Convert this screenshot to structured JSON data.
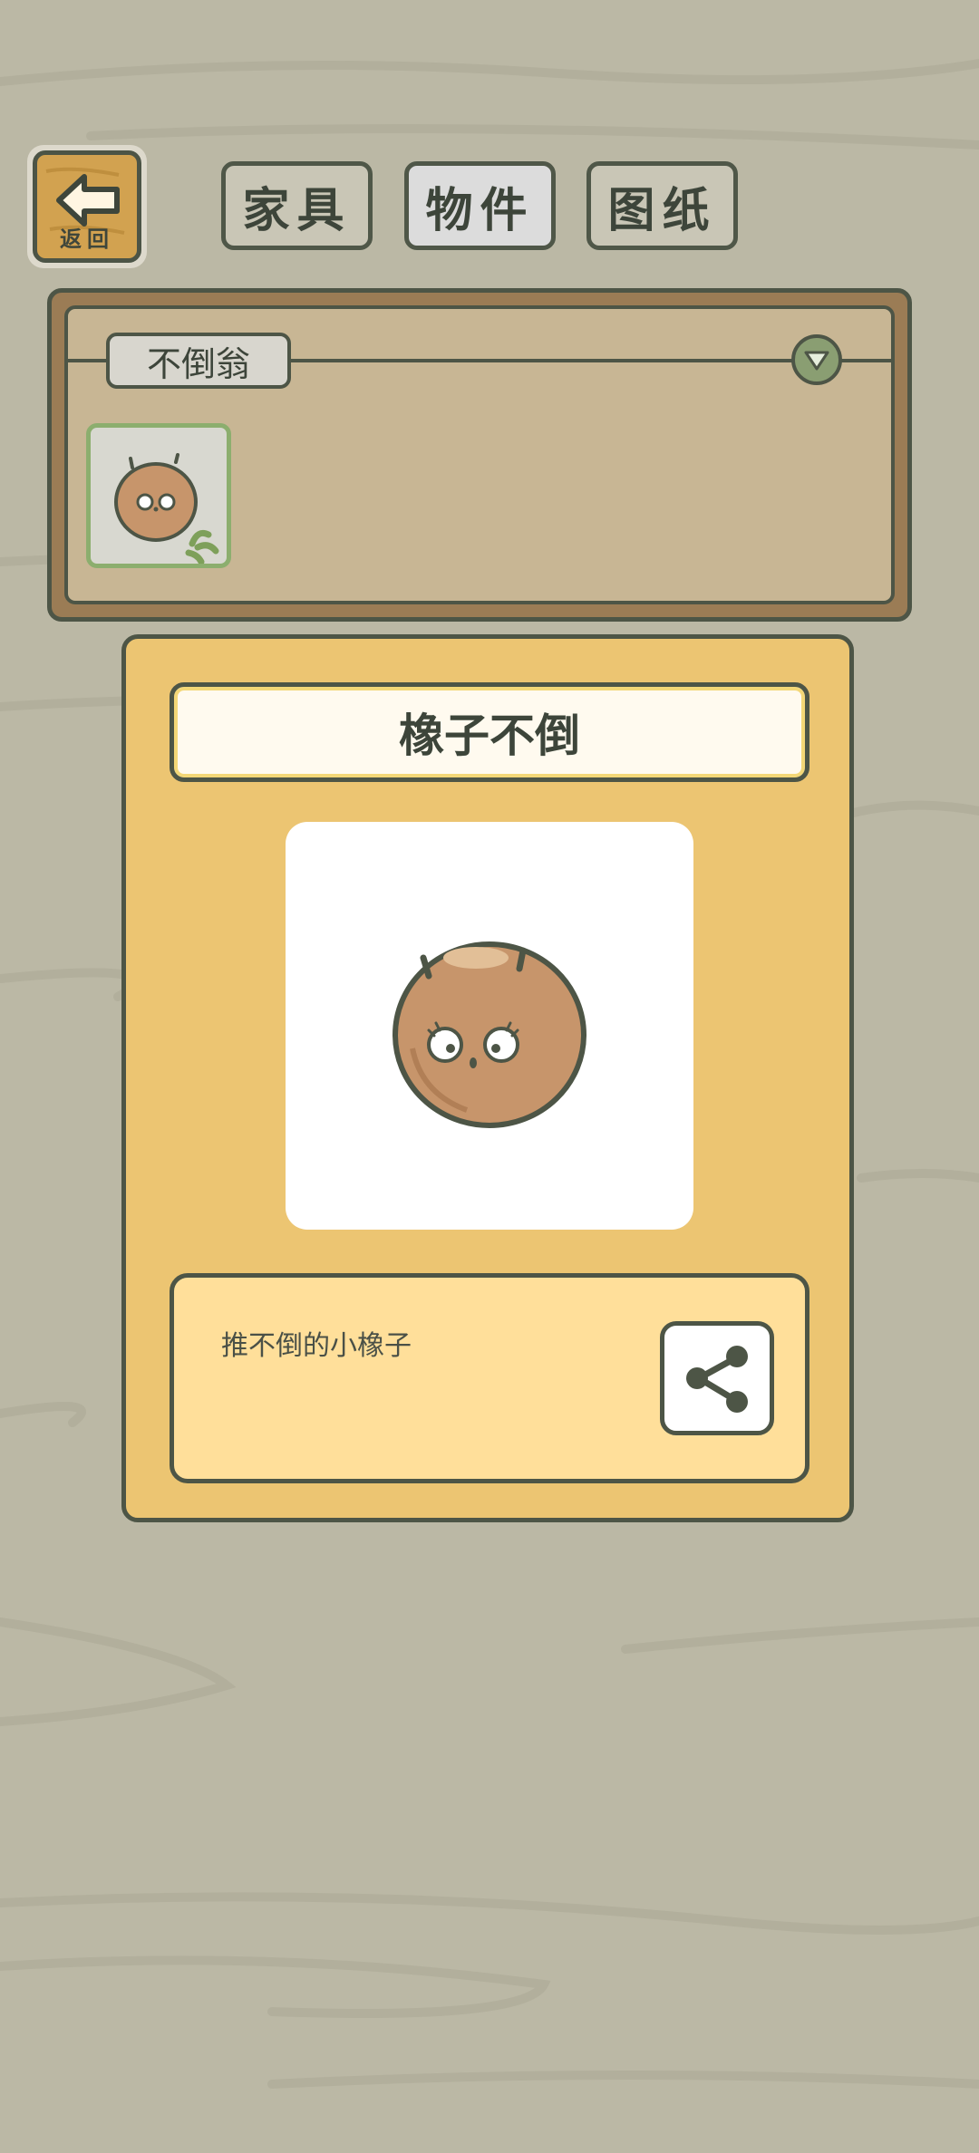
{
  "back_button": {
    "label": "返回",
    "icon": "arrow-left-icon"
  },
  "tabs": [
    {
      "label": "家具",
      "active": false
    },
    {
      "label": "物件",
      "active": true
    },
    {
      "label": "图纸",
      "active": false
    }
  ],
  "category": {
    "label": "不倒翁",
    "dropdown_icon": "chevron-down-icon"
  },
  "item_grid": [
    {
      "icon": "acorn-tumbler-icon",
      "selected": true
    }
  ],
  "detail": {
    "title": "橡子不倒",
    "description": "推不倒的小橡子",
    "share_icon": "share-icon"
  },
  "colors": {
    "background": "#bbb8a5",
    "card": "#ecc572",
    "description_box": "#ffdf9a",
    "category_panel": "#c8b694",
    "outline": "#4d5546",
    "accent_green": "#8cae6e"
  }
}
